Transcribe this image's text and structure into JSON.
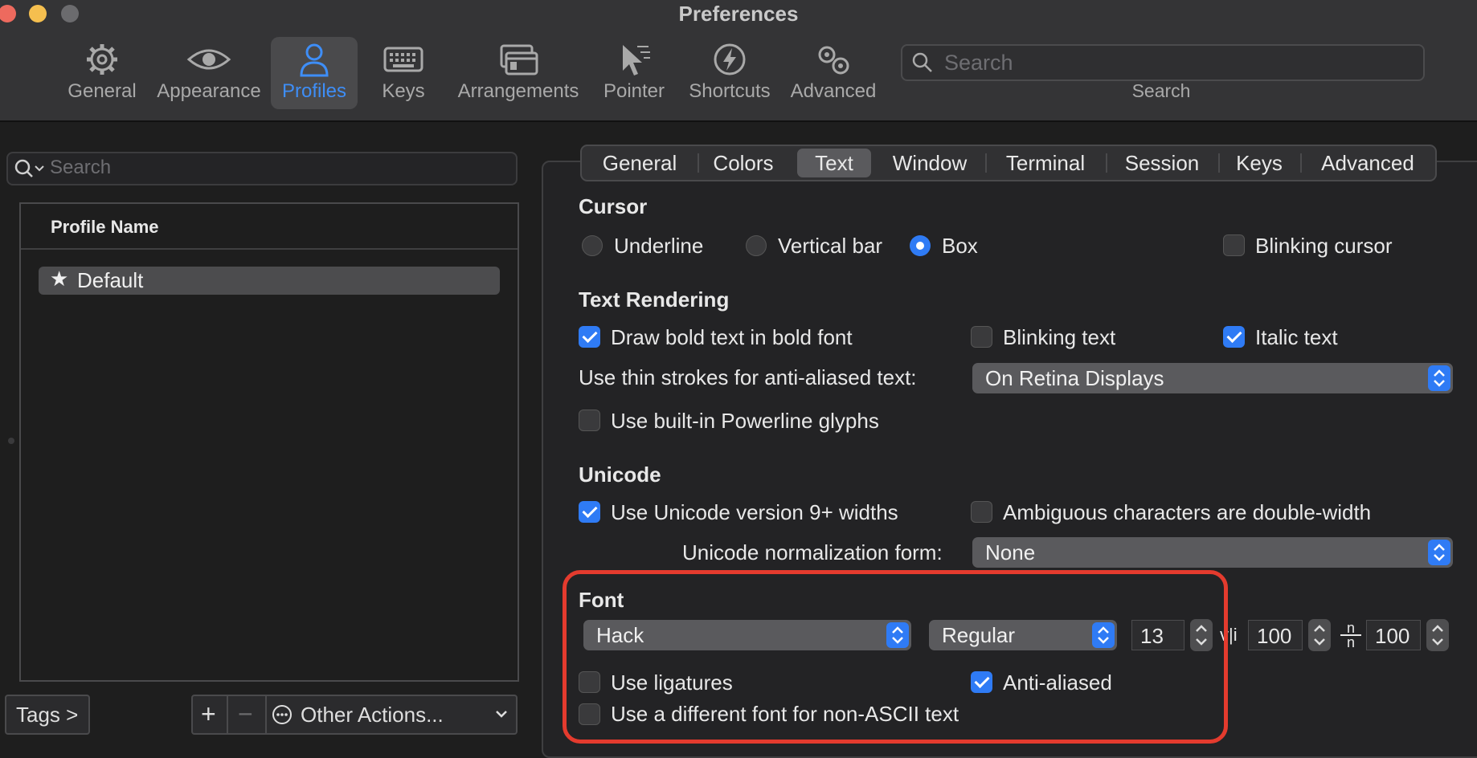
{
  "window": {
    "title": "Preferences"
  },
  "toolbar": {
    "items": [
      {
        "label": "General",
        "icon": "gear-icon"
      },
      {
        "label": "Appearance",
        "icon": "eye-icon"
      },
      {
        "label": "Profiles",
        "icon": "person-icon",
        "active": true
      },
      {
        "label": "Keys",
        "icon": "keyboard-icon"
      },
      {
        "label": "Arrangements",
        "icon": "windows-icon"
      },
      {
        "label": "Pointer",
        "icon": "pointer-icon"
      },
      {
        "label": "Shortcuts",
        "icon": "lightning-icon"
      },
      {
        "label": "Advanced",
        "icon": "gears-icon"
      }
    ],
    "search": {
      "placeholder": "Search",
      "label": "Search"
    }
  },
  "profiles": {
    "search_placeholder": "Search",
    "header": "Profile Name",
    "items": [
      {
        "name": "Default",
        "default": true
      }
    ],
    "tags_button": "Tags >",
    "add_button": "+",
    "remove_button": "−",
    "other_actions": "Other Actions..."
  },
  "tabs": [
    "General",
    "Colors",
    "Text",
    "Window",
    "Terminal",
    "Session",
    "Keys",
    "Advanced"
  ],
  "active_tab": "Text",
  "cursor": {
    "title": "Cursor",
    "options": [
      "Underline",
      "Vertical bar",
      "Box"
    ],
    "selected": "Box",
    "blinking_label": "Blinking cursor",
    "blinking": false
  },
  "text_rendering": {
    "title": "Text Rendering",
    "bold_label": "Draw bold text in bold font",
    "bold": true,
    "blinking_label": "Blinking text",
    "blinking": false,
    "italic_label": "Italic text",
    "italic": true,
    "thin_strokes_label": "Use thin strokes for anti-aliased text:",
    "thin_strokes_value": "On Retina Displays",
    "powerline_label": "Use built-in Powerline glyphs",
    "powerline": false
  },
  "unicode": {
    "title": "Unicode",
    "widths_label": "Use Unicode version 9+ widths",
    "widths": true,
    "ambiguous_label": "Ambiguous characters are double-width",
    "ambiguous": false,
    "normalization_label": "Unicode normalization form:",
    "normalization_value": "None"
  },
  "font": {
    "title": "Font",
    "family": "Hack",
    "style": "Regular",
    "size": "13",
    "vertical_spacing_icon": "v|i",
    "vertical_spacing": "100",
    "horizontal_spacing_icon": "n/n",
    "horizontal_spacing": "100",
    "ligatures_label": "Use ligatures",
    "ligatures": false,
    "antialiased_label": "Anti-aliased",
    "antialiased": true,
    "non_ascii_label": "Use a different font for non-ASCII text",
    "non_ascii": false
  },
  "colors": {
    "accent": "#2f7bf5",
    "highlight": "#e43b2e"
  }
}
